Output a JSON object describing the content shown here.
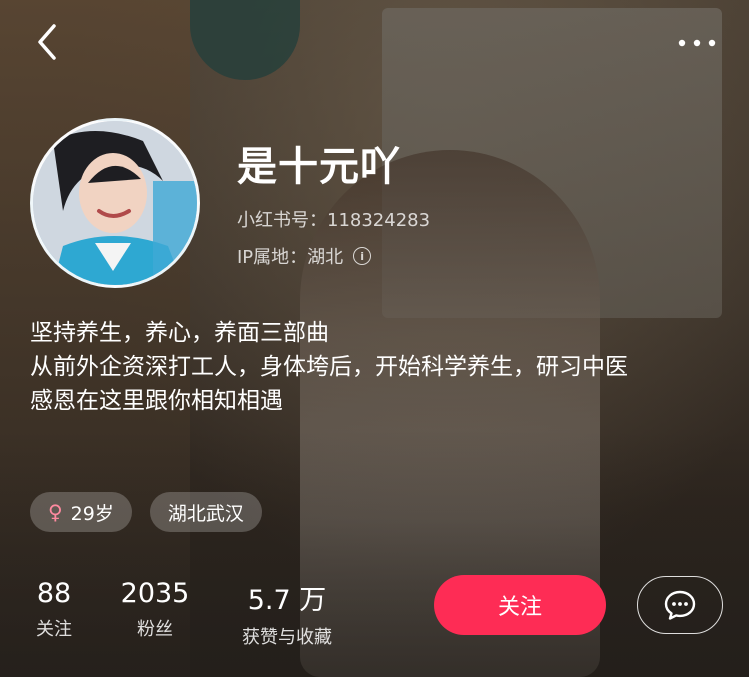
{
  "profile": {
    "nickname": "是十元吖",
    "xhs_id": "小红书号：118324283",
    "ip_location": "IP属地：湖北",
    "bio": [
      "坚持养生，养心，养面三部曲",
      "从前外企资深打工人，身体垮后，开始科学养生，研习中医",
      "感恩在这里跟你相知相遇"
    ],
    "tags": {
      "age": "29岁",
      "location": "湖北武汉"
    }
  },
  "stats": {
    "following": {
      "value": "88",
      "label": "关注"
    },
    "followers": {
      "value": "2035",
      "label": "粉丝"
    },
    "likes_collects": {
      "value": "5.7 万",
      "label": "获赞与收藏"
    }
  },
  "actions": {
    "follow_label": "关注"
  },
  "icons": {
    "back": "chevron-left-icon",
    "more": "more-dots-icon",
    "info": "info-icon",
    "female": "female-icon",
    "message": "chat-bubble-icon"
  },
  "colors": {
    "follow_button": "#fe2c55",
    "female_symbol": "#ff8aa0"
  }
}
